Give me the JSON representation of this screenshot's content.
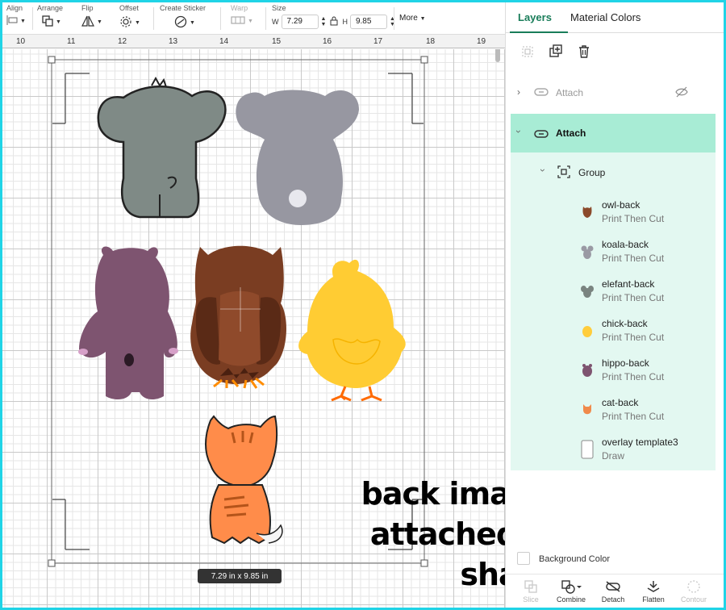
{
  "toolbar": {
    "align": {
      "label": "Align"
    },
    "arrange": {
      "label": "Arrange"
    },
    "flip": {
      "label": "Flip"
    },
    "offset": {
      "label": "Offset"
    },
    "sticker": {
      "label": "Create Sticker"
    },
    "warp": {
      "label": "Warp"
    },
    "size": {
      "label": "Size",
      "w_label": "W",
      "w_value": "7.29",
      "h_label": "H",
      "h_value": "9.85"
    },
    "more_label": "More"
  },
  "ruler": {
    "numbers": [
      "10",
      "11",
      "12",
      "13",
      "14",
      "15",
      "16",
      "17",
      "18",
      "19"
    ]
  },
  "canvas": {
    "dimension_label": "7.29  in x 9.85  in",
    "overlay_line1": "back image group",
    "overlay_line2": "attached to base shape"
  },
  "panel": {
    "tabs": {
      "layers": "Layers",
      "material_colors": "Material Colors"
    },
    "attach_hidden": {
      "label": "Attach"
    },
    "attach_selected": {
      "label": "Attach"
    },
    "group": {
      "label": "Group"
    },
    "layers": [
      {
        "name": "owl-back",
        "type": "Print Then Cut",
        "color": "#8b4a2b"
      },
      {
        "name": "koala-back",
        "type": "Print Then Cut",
        "color": "#9a9aa4"
      },
      {
        "name": "elefant-back",
        "type": "Print Then Cut",
        "color": "#7a8480"
      },
      {
        "name": "chick-back",
        "type": "Print Then Cut",
        "color": "#ffcd3c"
      },
      {
        "name": "hippo-back",
        "type": "Print Then Cut",
        "color": "#7e5470"
      },
      {
        "name": "cat-back",
        "type": "Print Then Cut",
        "color": "#f08a4b"
      },
      {
        "name": "overlay template3",
        "type": "Draw",
        "color": "#ffffff"
      }
    ],
    "background_color_label": "Background Color",
    "bottom_tools": {
      "slice": "Slice",
      "combine": "Combine",
      "detach": "Detach",
      "flatten": "Flatten",
      "contour": "Contour"
    }
  },
  "colors": {
    "accent": "#1a7d5a",
    "selected_row": "#a8ecd5",
    "group_bg": "#e3f8f1",
    "border": "#20d4e6"
  }
}
